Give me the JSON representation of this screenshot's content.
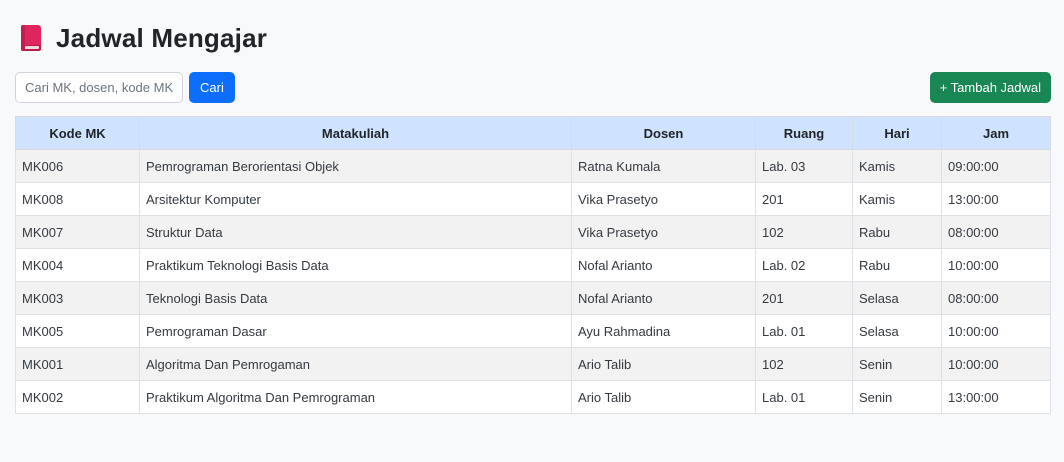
{
  "header": {
    "icon": "book-icon",
    "title": "Jadwal Mengajar"
  },
  "search": {
    "placeholder": "Cari MK, dosen, kode MK...",
    "value": "",
    "button_label": "Cari"
  },
  "actions": {
    "add_label": "+ Tambah Jadwal"
  },
  "colors": {
    "primary": "#0d6efd",
    "success": "#198754",
    "table_header": "#cfe2ff",
    "book_icon": "#e0245e"
  },
  "table": {
    "columns": [
      "Kode MK",
      "Matakuliah",
      "Dosen",
      "Ruang",
      "Hari",
      "Jam"
    ],
    "rows": [
      [
        "MK006",
        "Pemrograman Berorientasi Objek",
        "Ratna Kumala",
        "Lab. 03",
        "Kamis",
        "09:00:00"
      ],
      [
        "MK008",
        "Arsitektur Komputer",
        "Vika Prasetyo",
        "201",
        "Kamis",
        "13:00:00"
      ],
      [
        "MK007",
        "Struktur Data",
        "Vika Prasetyo",
        "102",
        "Rabu",
        "08:00:00"
      ],
      [
        "MK004",
        "Praktikum Teknologi Basis Data",
        "Nofal Arianto",
        "Lab. 02",
        "Rabu",
        "10:00:00"
      ],
      [
        "MK003",
        "Teknologi Basis Data",
        "Nofal Arianto",
        "201",
        "Selasa",
        "08:00:00"
      ],
      [
        "MK005",
        "Pemrograman Dasar",
        "Ayu Rahmadina",
        "Lab. 01",
        "Selasa",
        "10:00:00"
      ],
      [
        "MK001",
        "Algoritma Dan Pemrogaman",
        "Ario Talib",
        "102",
        "Senin",
        "10:00:00"
      ],
      [
        "MK002",
        "Praktikum Algoritma Dan Pemrograman",
        "Ario Talib",
        "Lab. 01",
        "Senin",
        "13:00:00"
      ]
    ]
  }
}
